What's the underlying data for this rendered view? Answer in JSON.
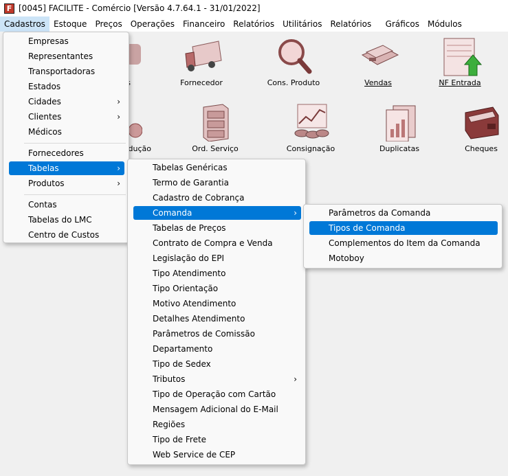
{
  "window": {
    "title": "[0045] FACILITE - Comércio [Versão 4.7.64.1 - 31/01/2022]",
    "app_icon": "F"
  },
  "menubar": [
    "Cadastros",
    "Estoque",
    "Preços",
    "Operações",
    "Financeiro",
    "Relatórios",
    "Utilitários",
    "Relatórios Fast",
    "Gráficos",
    "Módulos Personalizados"
  ],
  "launchers": {
    "row1": [
      "s",
      "Fornecedor",
      "Cons. Produto",
      "Vendas",
      "NF Entrada"
    ],
    "row2": [
      "dução",
      "Ord. Serviço",
      "Consignação",
      "Duplicatas",
      "Cheques"
    ]
  },
  "cadastros_menu": {
    "group1": [
      "Empresas",
      "Representantes",
      "Transportadoras",
      "Estados",
      "Cidades",
      "Clientes",
      "Médicos"
    ],
    "group2": [
      "Fornecedores",
      "Tabelas",
      "Produtos"
    ],
    "group3": [
      "Contas",
      "Tabelas do LMC",
      "Centro de Custos"
    ]
  },
  "tabelas_menu": [
    "Tabelas Genéricas",
    "Termo de Garantia",
    "Cadastro de Cobrança",
    "Comanda",
    "Tabelas de Preços",
    "Contrato de Compra e Venda",
    "Legislação do EPI",
    "Tipo Atendimento",
    "Tipo Orientação",
    "Motivo Atendimento",
    "Detalhes Atendimento",
    "Parâmetros de Comissão",
    "Departamento",
    "Tipo de Sedex",
    "Tributos",
    "Tipo de Operação com Cartão",
    "Mensagem Adicional do E-Mail",
    "Regiões",
    "Tipo de Frete",
    "Web Service de CEP"
  ],
  "comanda_menu": [
    "Parâmetros da Comanda",
    "Tipos de Comanda",
    "Complementos do Item da Comanda",
    "Motoboy"
  ],
  "colors": {
    "highlight": "#0078d7",
    "menu_bg": "#f9f9f9"
  }
}
